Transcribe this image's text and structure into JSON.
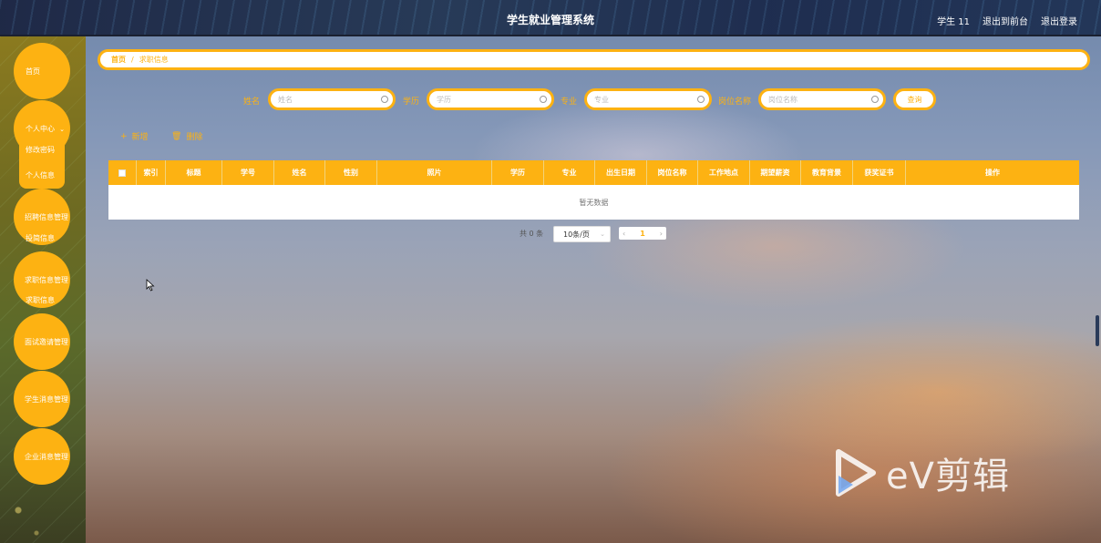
{
  "header": {
    "title": "学生就业管理系统",
    "user": "学生 11",
    "front_link": "退出到前台",
    "logout_link": "退出登录"
  },
  "sidebar": {
    "items": [
      {
        "label": "首页"
      },
      {
        "label": "个人中心",
        "children": [
          "修改密码",
          "个人信息"
        ]
      },
      {
        "label": "招聘信息管理",
        "children": [
          "投简信息"
        ]
      },
      {
        "label": "求职信息管理",
        "children": [
          "求职信息"
        ]
      },
      {
        "label": "面试邀请管理"
      },
      {
        "label": "学生消息管理"
      },
      {
        "label": "企业消息管理"
      }
    ]
  },
  "breadcrumb": {
    "home": "首页",
    "separator": "/",
    "current": "求职信息"
  },
  "search": {
    "fields": [
      {
        "label": "姓名",
        "placeholder": "姓名"
      },
      {
        "label": "学历",
        "placeholder": "学历"
      },
      {
        "label": "专业",
        "placeholder": "专业"
      },
      {
        "label": "岗位名称",
        "placeholder": "岗位名称"
      }
    ],
    "query_label": "查询"
  },
  "actions": {
    "add_label": "新增",
    "delete_label": "删除"
  },
  "table": {
    "columns": [
      "索引",
      "标题",
      "学号",
      "姓名",
      "性别",
      "照片",
      "学历",
      "专业",
      "出生日期",
      "岗位名称",
      "工作地点",
      "期望薪资",
      "教育背景",
      "获奖证书",
      "操作"
    ],
    "empty_text": "暂无数据"
  },
  "pagination": {
    "total_text": "共 0 条",
    "page_size": "10条/页",
    "current_page": "1"
  },
  "watermark": {
    "text": "eV剪辑"
  },
  "colors": {
    "accent": "#fdb212"
  }
}
